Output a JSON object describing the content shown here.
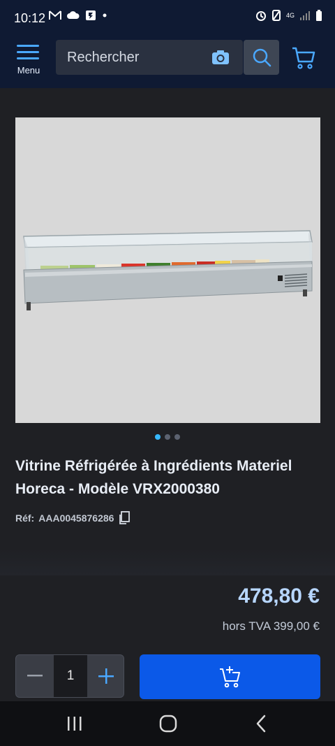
{
  "status_bar": {
    "time": "10:12",
    "left_icons": [
      "gmail-icon",
      "cloud-icon",
      "flipboard-icon",
      "dot-icon"
    ],
    "right_icons": [
      "alarm-icon",
      "no-signal-icon",
      "4g-icon",
      "signal-icon",
      "battery-icon"
    ],
    "network_label": "4G"
  },
  "header": {
    "menu_label": "Menu",
    "search_placeholder": "Rechercher",
    "accent_color": "#4aa8ff"
  },
  "carousel": {
    "image_alt": "refrigerated ingredient display with glass cover and food pans",
    "dot_count": 3,
    "active_index": 0
  },
  "product": {
    "title": "Vitrine Réfrigérée à Ingrédients Materiel Horeca - Modèle VRX2000380",
    "ref_label": "Réf:",
    "ref_value": "AAA0045876286",
    "price": "478,80 €",
    "price_excl_tax": "hors TVA 399,00 €"
  },
  "purchase": {
    "quantity": "1",
    "add_to_cart_color": "#0b59e8"
  },
  "nav_bar": {
    "buttons": [
      "recent-apps",
      "home",
      "back"
    ]
  }
}
